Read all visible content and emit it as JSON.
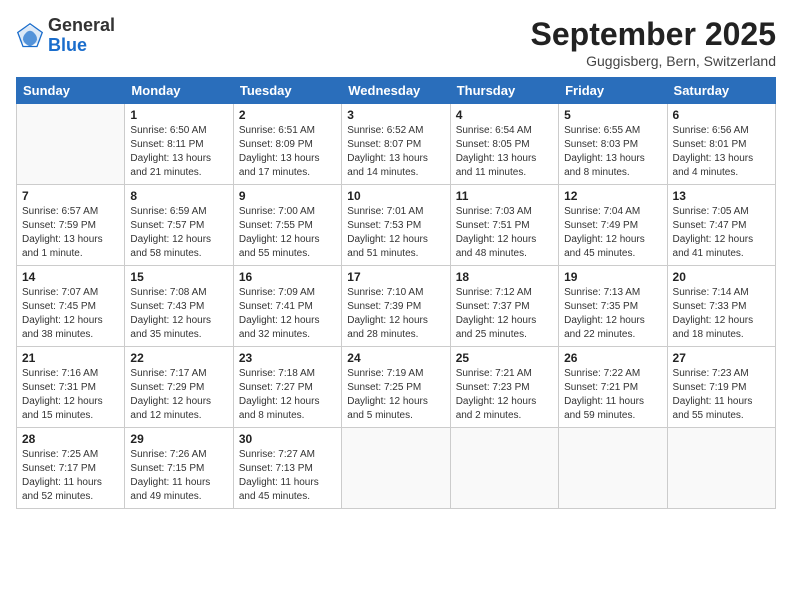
{
  "header": {
    "logo_general": "General",
    "logo_blue": "Blue",
    "month_title": "September 2025",
    "location": "Guggisberg, Bern, Switzerland"
  },
  "days_of_week": [
    "Sunday",
    "Monday",
    "Tuesday",
    "Wednesday",
    "Thursday",
    "Friday",
    "Saturday"
  ],
  "weeks": [
    [
      {
        "day": "",
        "info": ""
      },
      {
        "day": "1",
        "info": "Sunrise: 6:50 AM\nSunset: 8:11 PM\nDaylight: 13 hours\nand 21 minutes."
      },
      {
        "day": "2",
        "info": "Sunrise: 6:51 AM\nSunset: 8:09 PM\nDaylight: 13 hours\nand 17 minutes."
      },
      {
        "day": "3",
        "info": "Sunrise: 6:52 AM\nSunset: 8:07 PM\nDaylight: 13 hours\nand 14 minutes."
      },
      {
        "day": "4",
        "info": "Sunrise: 6:54 AM\nSunset: 8:05 PM\nDaylight: 13 hours\nand 11 minutes."
      },
      {
        "day": "5",
        "info": "Sunrise: 6:55 AM\nSunset: 8:03 PM\nDaylight: 13 hours\nand 8 minutes."
      },
      {
        "day": "6",
        "info": "Sunrise: 6:56 AM\nSunset: 8:01 PM\nDaylight: 13 hours\nand 4 minutes."
      }
    ],
    [
      {
        "day": "7",
        "info": "Sunrise: 6:57 AM\nSunset: 7:59 PM\nDaylight: 13 hours\nand 1 minute."
      },
      {
        "day": "8",
        "info": "Sunrise: 6:59 AM\nSunset: 7:57 PM\nDaylight: 12 hours\nand 58 minutes."
      },
      {
        "day": "9",
        "info": "Sunrise: 7:00 AM\nSunset: 7:55 PM\nDaylight: 12 hours\nand 55 minutes."
      },
      {
        "day": "10",
        "info": "Sunrise: 7:01 AM\nSunset: 7:53 PM\nDaylight: 12 hours\nand 51 minutes."
      },
      {
        "day": "11",
        "info": "Sunrise: 7:03 AM\nSunset: 7:51 PM\nDaylight: 12 hours\nand 48 minutes."
      },
      {
        "day": "12",
        "info": "Sunrise: 7:04 AM\nSunset: 7:49 PM\nDaylight: 12 hours\nand 45 minutes."
      },
      {
        "day": "13",
        "info": "Sunrise: 7:05 AM\nSunset: 7:47 PM\nDaylight: 12 hours\nand 41 minutes."
      }
    ],
    [
      {
        "day": "14",
        "info": "Sunrise: 7:07 AM\nSunset: 7:45 PM\nDaylight: 12 hours\nand 38 minutes."
      },
      {
        "day": "15",
        "info": "Sunrise: 7:08 AM\nSunset: 7:43 PM\nDaylight: 12 hours\nand 35 minutes."
      },
      {
        "day": "16",
        "info": "Sunrise: 7:09 AM\nSunset: 7:41 PM\nDaylight: 12 hours\nand 32 minutes."
      },
      {
        "day": "17",
        "info": "Sunrise: 7:10 AM\nSunset: 7:39 PM\nDaylight: 12 hours\nand 28 minutes."
      },
      {
        "day": "18",
        "info": "Sunrise: 7:12 AM\nSunset: 7:37 PM\nDaylight: 12 hours\nand 25 minutes."
      },
      {
        "day": "19",
        "info": "Sunrise: 7:13 AM\nSunset: 7:35 PM\nDaylight: 12 hours\nand 22 minutes."
      },
      {
        "day": "20",
        "info": "Sunrise: 7:14 AM\nSunset: 7:33 PM\nDaylight: 12 hours\nand 18 minutes."
      }
    ],
    [
      {
        "day": "21",
        "info": "Sunrise: 7:16 AM\nSunset: 7:31 PM\nDaylight: 12 hours\nand 15 minutes."
      },
      {
        "day": "22",
        "info": "Sunrise: 7:17 AM\nSunset: 7:29 PM\nDaylight: 12 hours\nand 12 minutes."
      },
      {
        "day": "23",
        "info": "Sunrise: 7:18 AM\nSunset: 7:27 PM\nDaylight: 12 hours\nand 8 minutes."
      },
      {
        "day": "24",
        "info": "Sunrise: 7:19 AM\nSunset: 7:25 PM\nDaylight: 12 hours\nand 5 minutes."
      },
      {
        "day": "25",
        "info": "Sunrise: 7:21 AM\nSunset: 7:23 PM\nDaylight: 12 hours\nand 2 minutes."
      },
      {
        "day": "26",
        "info": "Sunrise: 7:22 AM\nSunset: 7:21 PM\nDaylight: 11 hours\nand 59 minutes."
      },
      {
        "day": "27",
        "info": "Sunrise: 7:23 AM\nSunset: 7:19 PM\nDaylight: 11 hours\nand 55 minutes."
      }
    ],
    [
      {
        "day": "28",
        "info": "Sunrise: 7:25 AM\nSunset: 7:17 PM\nDaylight: 11 hours\nand 52 minutes."
      },
      {
        "day": "29",
        "info": "Sunrise: 7:26 AM\nSunset: 7:15 PM\nDaylight: 11 hours\nand 49 minutes."
      },
      {
        "day": "30",
        "info": "Sunrise: 7:27 AM\nSunset: 7:13 PM\nDaylight: 11 hours\nand 45 minutes."
      },
      {
        "day": "",
        "info": ""
      },
      {
        "day": "",
        "info": ""
      },
      {
        "day": "",
        "info": ""
      },
      {
        "day": "",
        "info": ""
      }
    ]
  ]
}
